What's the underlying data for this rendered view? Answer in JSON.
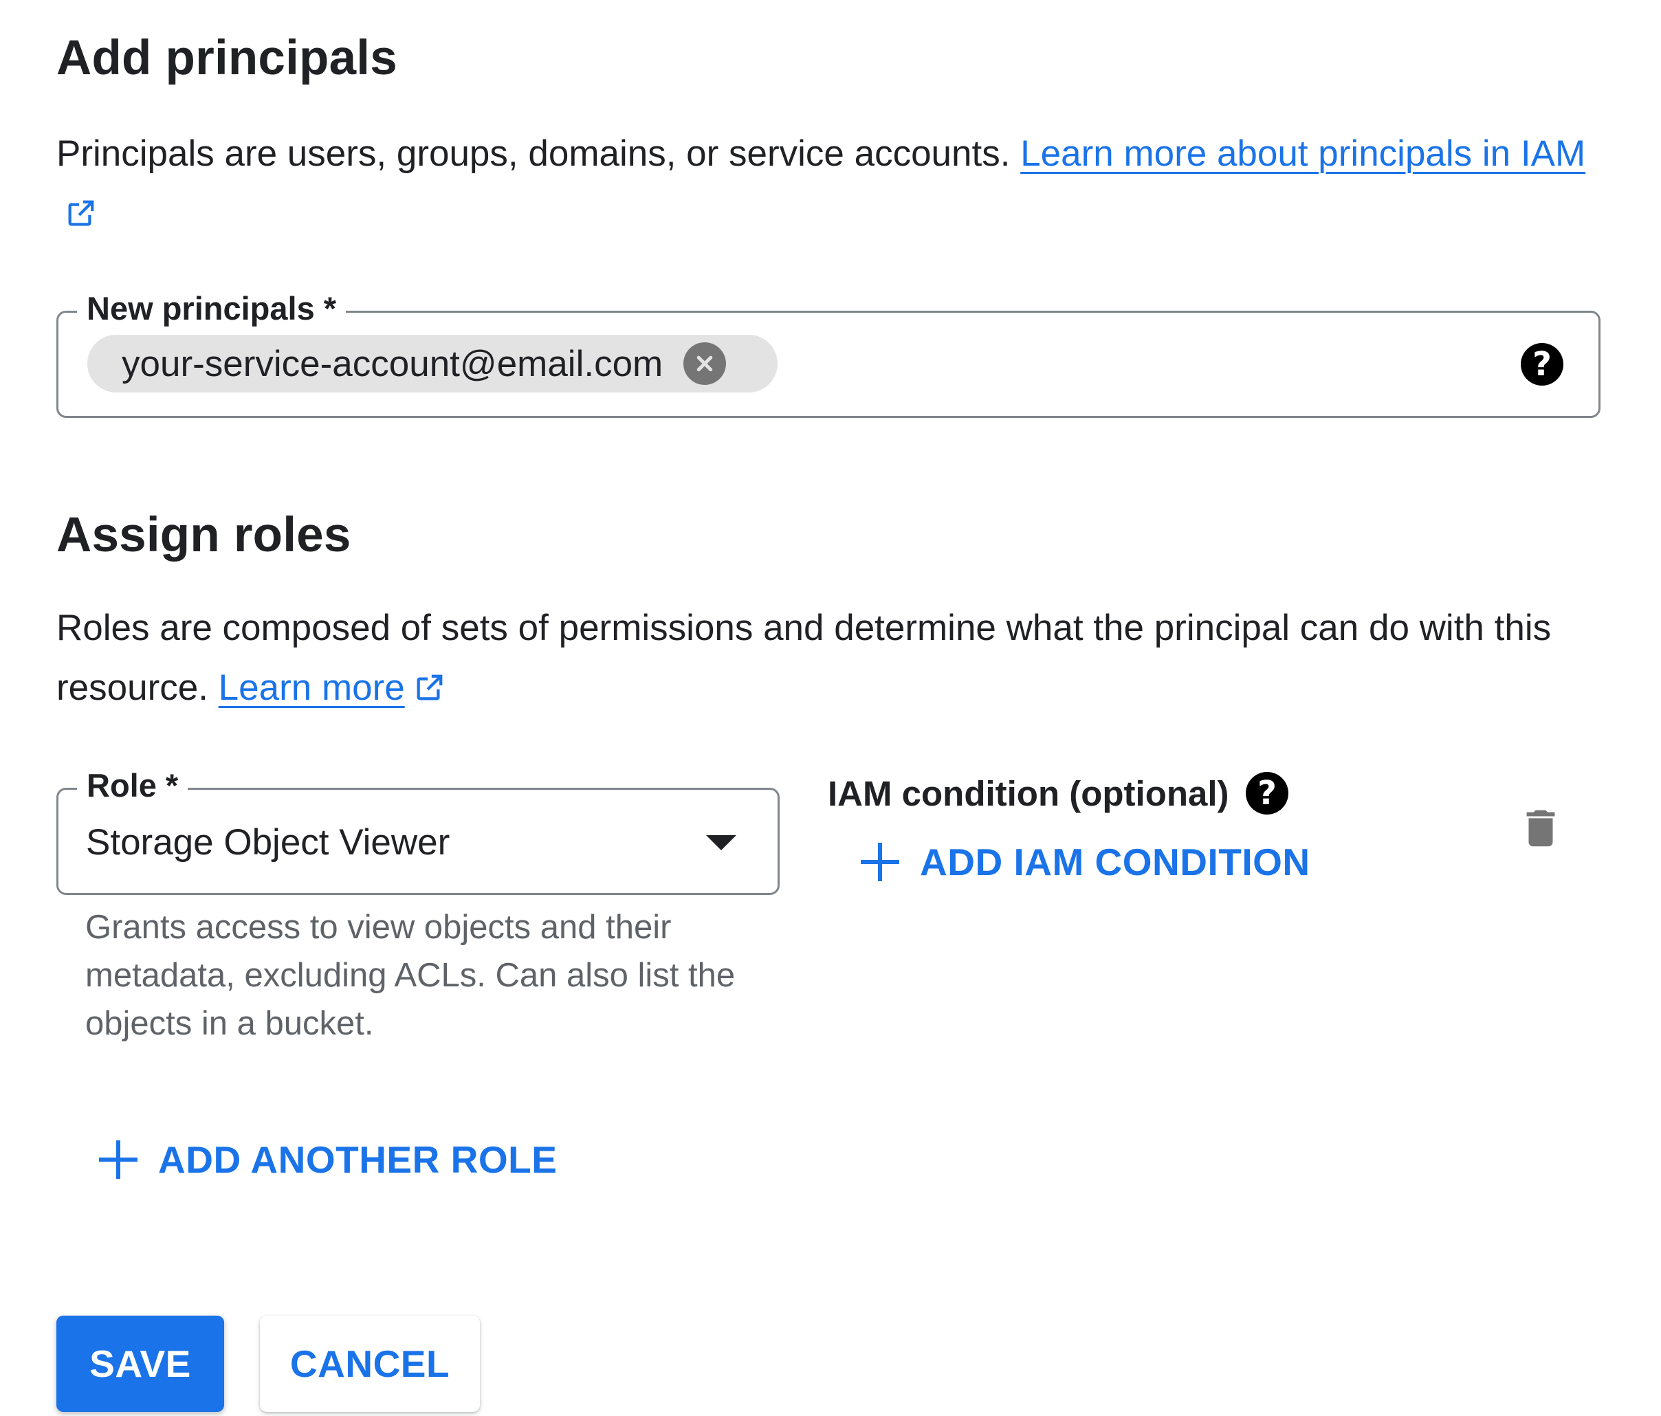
{
  "add_principals": {
    "title": "Add principals",
    "description": "Principals are users, groups, domains, or service accounts.",
    "learn_more_link": "Learn more about principals in IAM",
    "field_label": "New principals *",
    "chip_value": "your-service-account@email.com"
  },
  "assign_roles": {
    "title": "Assign roles",
    "description": "Roles are composed of sets of permissions and determine what the principal can do with this resource.",
    "learn_more_link": "Learn more",
    "role_label": "Role *",
    "role_value": "Storage Object Viewer",
    "role_hint": "Grants access to view objects and their metadata, excluding ACLs. Can also list the objects in a bucket.",
    "iam_condition_label": "IAM condition (optional)",
    "add_iam_condition": "ADD IAM CONDITION",
    "add_another_role": "ADD ANOTHER ROLE"
  },
  "actions": {
    "save": "SAVE",
    "cancel": "CANCEL"
  },
  "colors": {
    "accent": "#1a73e8",
    "chip_bg": "#e3e3e3",
    "border": "#80868b"
  },
  "icons": [
    "open-in-new-icon",
    "clear-chip-icon",
    "help-icon",
    "dropdown-arrow-icon",
    "add-icon",
    "delete-icon"
  ]
}
